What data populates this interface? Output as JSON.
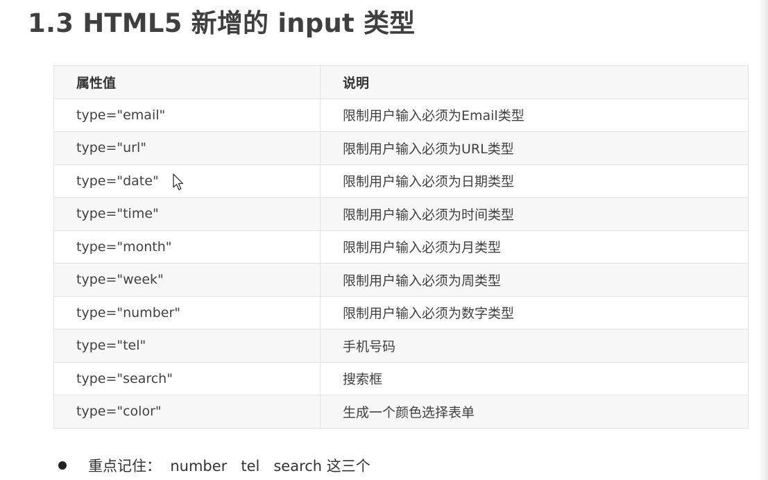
{
  "title": "1.3 HTML5 新增的 input 类型",
  "table": {
    "headers": [
      "属性值",
      "说明"
    ],
    "rows": [
      [
        "type=\"email\"",
        "限制用户输入必须为Email类型"
      ],
      [
        "type=\"url\"",
        "限制用户输入必须为URL类型"
      ],
      [
        "type=\"date\"",
        "限制用户输入必须为日期类型"
      ],
      [
        "type=\"time\"",
        "限制用户输入必须为时间类型"
      ],
      [
        "type=\"month\"",
        "限制用户输入必须为月类型"
      ],
      [
        "type=\"week\"",
        "限制用户输入必须为周类型"
      ],
      [
        "type=\"number\"",
        "限制用户输入必须为数字类型"
      ],
      [
        "type=\"tel\"",
        "手机号码"
      ],
      [
        "type=\"search\"",
        "搜索框"
      ],
      [
        "type=\"color\"",
        "生成一个颜色选择表单"
      ]
    ]
  },
  "note": {
    "text": "重点记住：  number   tel   search 这三个"
  },
  "cursor": {
    "icon": "arrow-cursor-icon"
  },
  "colors": {
    "header_bg": "#f7f7f7",
    "border": "#e4e4e4",
    "title": "#3f3f3f"
  }
}
